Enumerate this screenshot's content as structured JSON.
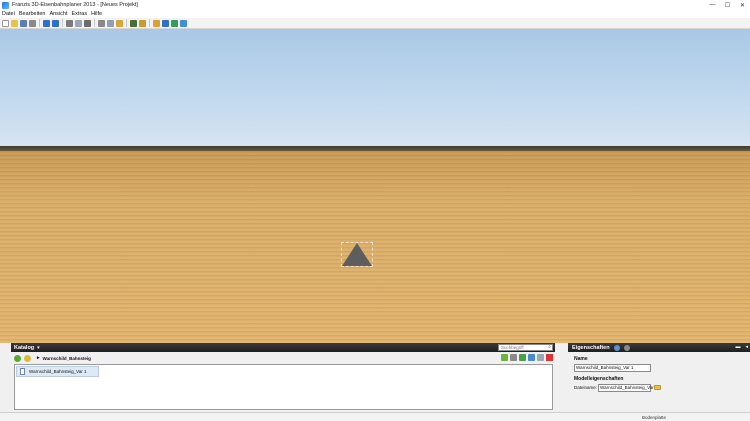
{
  "window": {
    "title": "Franzis 3D-Eisenbahnplaner 2013 - [Neues Projekt]",
    "controls": {
      "minimize": "—",
      "maximize": "☐",
      "close": "✕"
    }
  },
  "menu": [
    "Datei",
    "Bearbeiten",
    "Ansicht",
    "Extras",
    "Hilfe"
  ],
  "toolbar": {
    "icons": [
      "new-icon",
      "open-icon",
      "save-icon",
      "print-icon",
      "undo-icon",
      "redo-icon",
      "select-icon",
      "copy-icon",
      "grid-icon",
      "cut-icon",
      "paste-icon",
      "layer-icon",
      "material-icon",
      "lock-icon",
      "hand-icon",
      "help-icon",
      "sound-icon",
      "export-icon"
    ],
    "colors": {
      "new-icon": "#ffffff",
      "open-icon": "#e8c24a",
      "save-icon": "#5a7fb8",
      "print-icon": "#8a8a8a",
      "undo-icon": "#2f6fc9",
      "redo-icon": "#2f6fc9",
      "select-icon": "#7a7a7a",
      "copy-icon": "#9aa7b6",
      "grid-icon": "#6b6b6b",
      "cut-icon": "#888888",
      "paste-icon": "#8fa0b2",
      "layer-icon": "#d9a63a",
      "material-icon": "#4c6e2f",
      "lock-icon": "#c99a2d",
      "hand-icon": "#e0a030",
      "help-icon": "#2f6fc9",
      "sound-icon": "#3a9a5a",
      "export-icon": "#3f8fd1"
    }
  },
  "catalog": {
    "title": "Katalog",
    "caret": "▾",
    "search_placeholder": "Suchbegriff",
    "breadcrumb": "Warnschild_Bahnsteig",
    "breadcrumb_arrow": "▸",
    "items": [
      {
        "label": "Warnschild_Bahnsteig_Var 1"
      }
    ]
  },
  "properties": {
    "title": "Eigenschaften",
    "name_label": "Name",
    "name_value": "Warnschild_Bahnsteig_Var 1",
    "model_label": "Modelleigenschaften",
    "filename_label": "Dateiname:",
    "filename_value": "Warnschild_Bahnsteig_Var",
    "header_controls": [
      "▬",
      "◂"
    ]
  },
  "status": {
    "text": "Bodenplatte"
  },
  "colors": {
    "sky": "#c5dbef",
    "ground": "#d9ad68",
    "panel_header": "#2a2a2a"
  }
}
